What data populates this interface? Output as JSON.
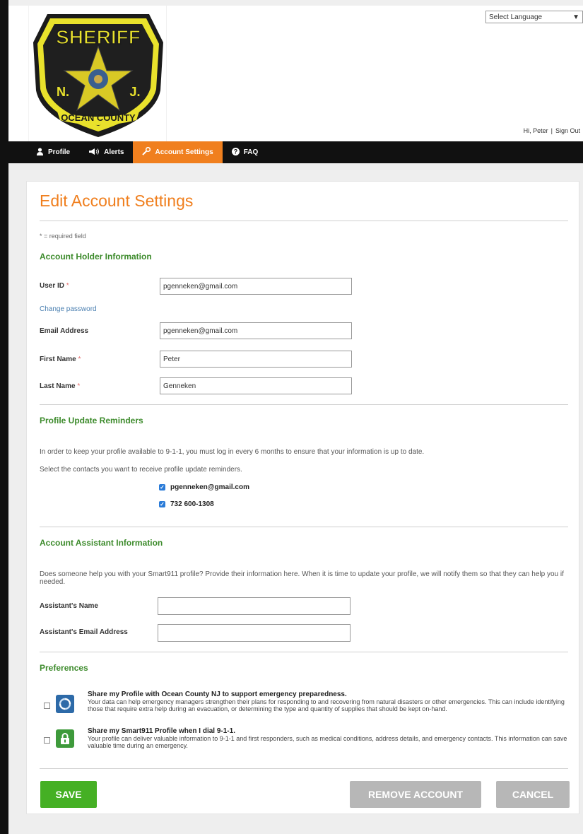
{
  "header": {
    "logo": {
      "badge_top": "SHERIFF",
      "badge_left": "N.",
      "badge_right": "J.",
      "badge_bottom": "OCEAN COUNTY"
    },
    "language_select": "Select Language",
    "greeting": "Hi, Peter",
    "separator": "|",
    "sign_out": "Sign Out"
  },
  "nav": {
    "items": [
      {
        "label": "Profile",
        "icon": "person-icon",
        "active": false
      },
      {
        "label": "Alerts",
        "icon": "megaphone-icon",
        "active": false
      },
      {
        "label": "Account Settings",
        "icon": "wrench-icon",
        "active": true
      },
      {
        "label": "FAQ",
        "icon": "question-circle-icon",
        "active": false
      }
    ]
  },
  "page": {
    "title": "Edit Account Settings",
    "required_note": "* = required field"
  },
  "account_holder": {
    "title": "Account Holder Information",
    "user_id_label": "User ID",
    "user_id_value": "pgenneken@gmail.com",
    "change_password": "Change password",
    "email_label": "Email Address",
    "email_value": "pgenneken@gmail.com",
    "first_name_label": "First Name",
    "first_name_value": "Peter",
    "last_name_label": "Last Name",
    "last_name_value": "Genneken",
    "required_mark": "*"
  },
  "reminders": {
    "title": "Profile Update Reminders",
    "text1": "In order to keep your profile available to 9-1-1, you must log in every 6 months to ensure that your information is up to date.",
    "text2": "Select the contacts you want to receive profile update reminders.",
    "contacts": [
      {
        "label": "pgenneken@gmail.com",
        "checked": true
      },
      {
        "label": "732 600-1308",
        "checked": true
      }
    ]
  },
  "assistant": {
    "title": "Account Assistant Information",
    "text": "Does someone help you with your Smart911 profile? Provide their information here. When it is time to update your profile, we will notify them so that they can help you if needed.",
    "name_label": "Assistant's Name",
    "name_value": "",
    "email_label": "Assistant's Email Address",
    "email_value": ""
  },
  "preferences": {
    "title": "Preferences",
    "items": [
      {
        "heading": "Share my Profile with Ocean County NJ to support emergency preparedness.",
        "body": "Your data can help emergency managers strengthen their plans for responding to and recovering from natural disasters or other emergencies. This can include identifying those that require extra help during an evacuation, or determining the type and quantity of supplies that should be kept on-hand.",
        "icon": "lifecycle-icon",
        "color": "#2d6aa8",
        "checked": false
      },
      {
        "heading": "Share my Smart911 Profile when I dial 9-1-1.",
        "body": "Your profile can deliver valuable information to 9-1-1 and first responders, such as medical conditions, address details, and emergency contacts. This information can save valuable time during an emergency.",
        "icon": "lock-icon",
        "color": "#3e9a3b",
        "checked": false
      }
    ]
  },
  "buttons": {
    "save": "SAVE",
    "remove": "REMOVE ACCOUNT",
    "cancel": "CANCEL"
  },
  "colors": {
    "accent": "#f07f1e",
    "section_green": "#3d8b2c",
    "save_green": "#45b024",
    "nav_bg": "#111111"
  }
}
